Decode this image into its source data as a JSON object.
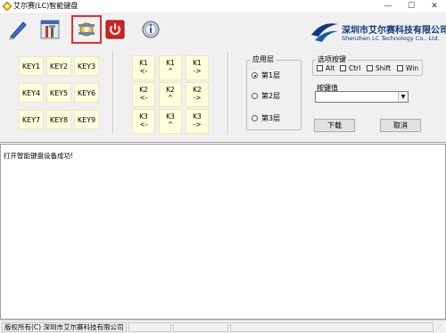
{
  "window": {
    "title": "艾尔赛(LC)智能键盘",
    "minimize_glyph": "—",
    "maximize_glyph": "☐",
    "close_glyph": "✕"
  },
  "toolbar": {
    "buttons": [
      {
        "icon": "pen-icon"
      },
      {
        "icon": "tools-icon"
      },
      {
        "icon": "settings-icon",
        "active": true
      },
      {
        "icon": "power-icon"
      },
      {
        "icon": "info-icon"
      }
    ],
    "logo": {
      "cn": "深圳市艾尔赛科技有限公司",
      "en": "Shenzhen LC Technology Co., Ltd."
    }
  },
  "keys": {
    "row1": [
      "KEY1",
      "KEY2",
      "KEY3"
    ],
    "row2": [
      "KEY4",
      "KEY5",
      "KEY6"
    ],
    "row3": [
      "KEY7",
      "KEY8",
      "KEY9"
    ]
  },
  "knobs": {
    "row1": [
      {
        "name": "K1",
        "sym": "<-"
      },
      {
        "name": "K1",
        "sym": "^"
      },
      {
        "name": "K1",
        "sym": "->"
      }
    ],
    "row2": [
      {
        "name": "K2",
        "sym": "<-"
      },
      {
        "name": "K2",
        "sym": "^"
      },
      {
        "name": "K2",
        "sym": "->"
      }
    ],
    "row3": [
      {
        "name": "K3",
        "sym": "<-"
      },
      {
        "name": "K3",
        "sym": "^"
      },
      {
        "name": "K3",
        "sym": "->"
      }
    ]
  },
  "layers": {
    "legend": "应用层",
    "options": [
      "第1层",
      "第2层",
      "第3层"
    ],
    "selected_index": 0
  },
  "modifiers": {
    "legend": "选项按键",
    "options": [
      "Alt",
      "Ctrl",
      "Shift",
      "Win"
    ]
  },
  "keyvalue": {
    "legend": "按键值",
    "value": ""
  },
  "actions": {
    "download": "下载",
    "cancel": "取消"
  },
  "log": {
    "lines": [
      "打开智能键盘设备成功!"
    ]
  },
  "status": {
    "copyright": "版权所有(C) 深圳市艾尔赛科技有限公司"
  }
}
